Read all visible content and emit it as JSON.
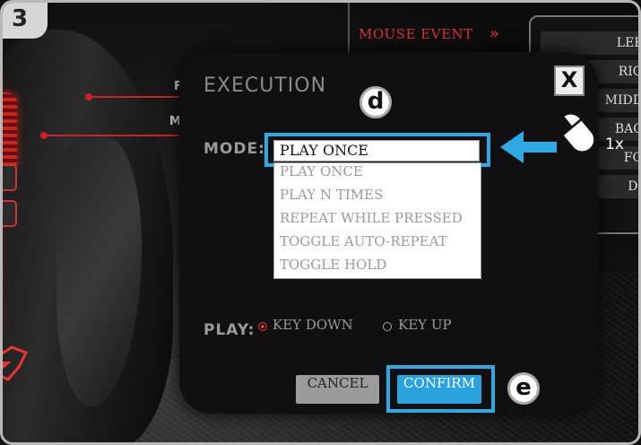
{
  "step_badge": "3",
  "background": {
    "mouse_event_label": "MOUSE EVENT",
    "mouse_event_chevron": "»",
    "callout_letters": [
      "F",
      "M"
    ],
    "event_buttons": [
      "LEF",
      "RIG",
      "MIDD",
      "BAC",
      "FO",
      "DI"
    ]
  },
  "dialog": {
    "title": "EXECUTION",
    "close_label": "X",
    "marker_d": "d",
    "marker_e": "e",
    "mode": {
      "label": "MODE:",
      "selected": "PLAY ONCE",
      "options": [
        "PLAY ONCE",
        "PLAY N TIMES",
        "REPEAT WHILE PRESSED",
        "TOGGLE AUTO-REPEAT",
        "TOGGLE HOLD"
      ]
    },
    "hint": {
      "icon": "mouse-left-click-icon",
      "count": "1x"
    },
    "play": {
      "label": "PLAY:",
      "options": [
        {
          "label": "KEY DOWN",
          "selected": true
        },
        {
          "label": "KEY UP",
          "selected": false
        }
      ]
    },
    "cancel_label": "CANCEL",
    "confirm_label": "CONFIRM"
  },
  "colors": {
    "accent_blue": "#2ea9e4",
    "accent_red": "#d8343a"
  }
}
